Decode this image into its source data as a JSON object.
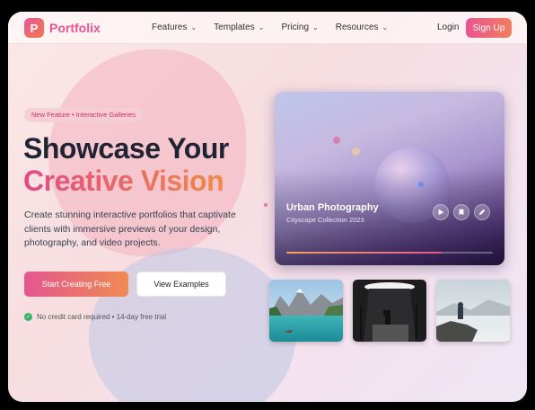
{
  "nav": {
    "logo_letter": "P",
    "brand": "Portfolix",
    "menu": [
      {
        "label": "Features"
      },
      {
        "label": "Templates"
      },
      {
        "label": "Pricing"
      },
      {
        "label": "Resources"
      }
    ],
    "login": "Login",
    "signup": "Sign Up"
  },
  "hero": {
    "badge": "New Feature • Interactive Galleries",
    "title_line1": "Showcase Your",
    "title_line2": "Creative Vision",
    "description": "Create stunning interactive portfolios that captivate clients with immersive previews of your design, photography, and video projects.",
    "primary_button": "Start Creating Free",
    "secondary_button": "View Examples",
    "note": "No credit card required • 14-day free trial"
  },
  "feature_card": {
    "title": "Urban Photography",
    "subtitle": "Cityscape Collection 2023",
    "actions": [
      "play-icon",
      "bookmark-icon",
      "edit-icon"
    ],
    "progress": 0.75
  },
  "thumbnails": [
    {
      "name": "mountain-lake"
    },
    {
      "name": "studio-setup"
    },
    {
      "name": "hiker-overlook"
    }
  ],
  "colors": {
    "accent_pink": "#e8558f",
    "accent_orange": "#f08a48",
    "heading": "#1f2333",
    "success": "#34b569"
  }
}
